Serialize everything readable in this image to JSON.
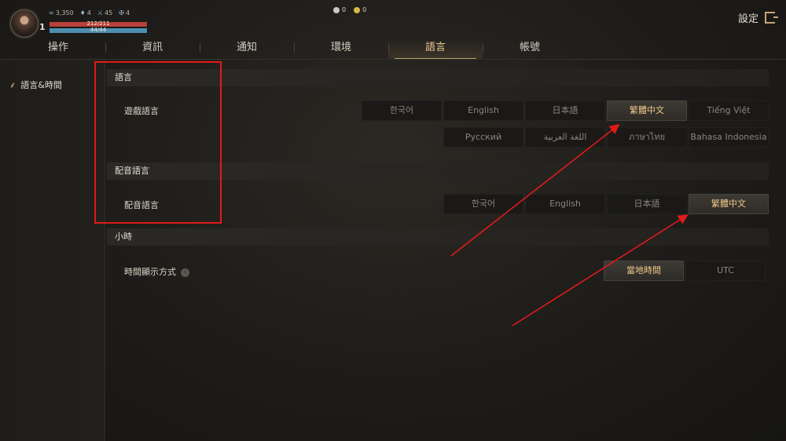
{
  "player": {
    "level": "1",
    "stats": [
      {
        "icon": "feather-icon",
        "glyph": "≈",
        "value": "3,350"
      },
      {
        "icon": "helmet-icon",
        "glyph": "♦",
        "value": "4"
      },
      {
        "icon": "sword-icon",
        "glyph": "⚔",
        "value": "45"
      },
      {
        "icon": "crossed-swords-icon",
        "glyph": "✠",
        "value": "4"
      }
    ],
    "hp_text": "212/211",
    "mp_text": "44/44",
    "hp_fraction": 1.0,
    "mp_fraction": 1.0
  },
  "currency": [
    {
      "icon": "diamond-icon",
      "value": "0",
      "color": "#c9c9c9"
    },
    {
      "icon": "gold-coin-icon",
      "value": "0",
      "color": "#d9b64a"
    }
  ],
  "settings_label": "設定",
  "tabs": [
    "操作",
    "資訊",
    "通知",
    "環境",
    "語言",
    "帳號"
  ],
  "active_tab": "語言",
  "sidebar": {
    "items": [
      {
        "label": "語言&時間",
        "icon": "language-icon"
      }
    ]
  },
  "sections": {
    "language": {
      "header": "語言",
      "game_language_label": "遊戲語言",
      "options_row1": [
        "한국어",
        "English",
        "日本語",
        "繁體中文",
        "Tiếng Việt"
      ],
      "options_row2": [
        "Русский",
        "اللغة العربية",
        "ภาษาไทย",
        "Bahasa Indonesia"
      ],
      "selected": "繁體中文"
    },
    "voice": {
      "header": "配音語言",
      "voice_language_label": "配音語言",
      "options": [
        "한국어",
        "English",
        "日本語",
        "繁體中文"
      ],
      "selected": "繁體中文"
    },
    "time": {
      "header": "小時",
      "time_display_label": "時間顯示方式",
      "info_glyph": "i",
      "options": [
        "當地時間",
        "UTC"
      ],
      "selected": "當地時間"
    }
  },
  "colors": {
    "accent": "#e9c892",
    "annotation_red": "#e01a1a"
  }
}
